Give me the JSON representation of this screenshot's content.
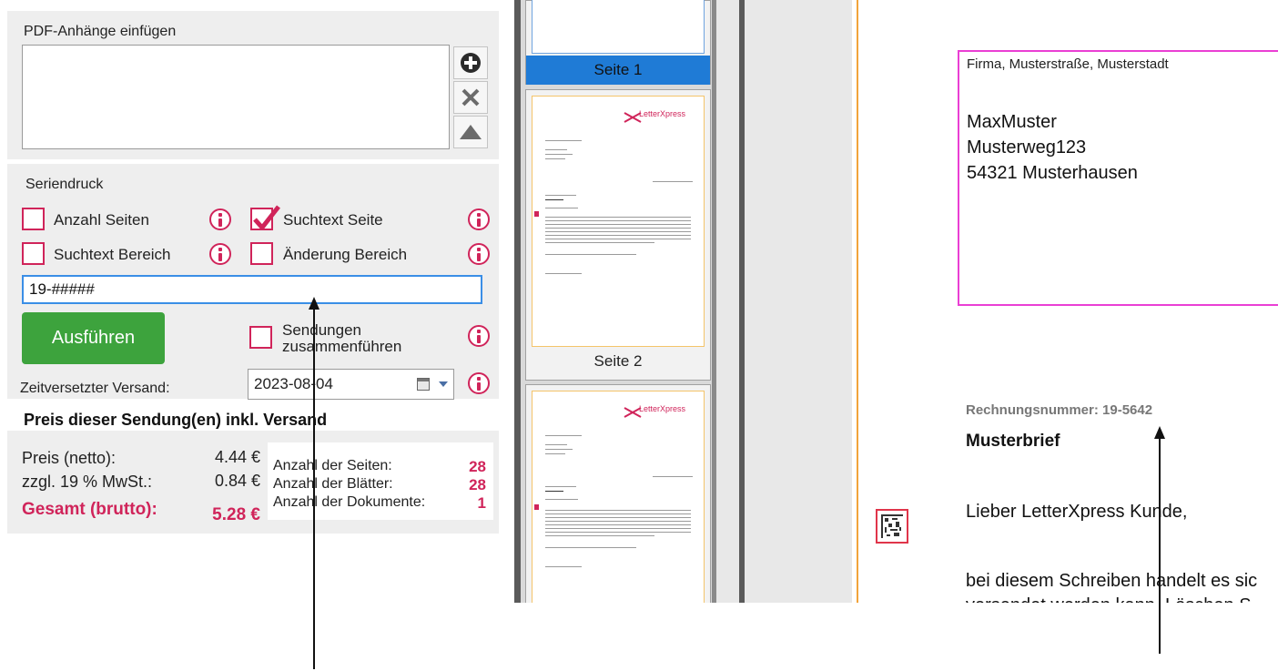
{
  "attachments": {
    "title": "PDF-Anhänge einfügen",
    "buttons": {
      "add_icon": "plus-circle-icon",
      "remove_icon": "close-icon",
      "up_icon": "arrow-up-icon"
    }
  },
  "serial": {
    "title": "Seriendruck",
    "options": [
      {
        "label": "Anzahl Seiten",
        "checked": false
      },
      {
        "label": "Suchtext Seite",
        "checked": true
      },
      {
        "label": "Suchtext Bereich",
        "checked": false
      },
      {
        "label": "Änderung Bereich",
        "checked": false
      }
    ],
    "search_value": "19-#####",
    "run_label": "Ausführen",
    "merge_label_line1": "Sendungen",
    "merge_label_line2": "zusammenführen",
    "delayed_label": "Zeitversetzter Versand:",
    "delayed_date": "2023-08-04"
  },
  "price": {
    "heading": "Preis dieser Sendung(en) inkl. Versand",
    "net_label": "Preis (netto):",
    "net_value": "4.44 €",
    "vat_label": "zzgl. 19 % MwSt.:",
    "vat_value": "0.84 €",
    "total_label": "Gesamt (brutto):",
    "total_value": "5.28 €",
    "pages_label": "Anzahl der Seiten:",
    "pages_value": "28",
    "sheets_label": "Anzahl der Blätter:",
    "sheets_value": "28",
    "docs_label": "Anzahl der Dokumente:",
    "docs_value": "1",
    "accent_color": "#d0245a"
  },
  "thumbnails": {
    "pages": [
      {
        "label": "Seite 1",
        "selected": true
      },
      {
        "label": "Seite 2",
        "selected": false
      },
      {
        "label": "",
        "selected": false
      }
    ],
    "logo_text": "LetterXpress"
  },
  "document": {
    "sender_line": "Firma, Musterstraße, Musterstadt",
    "recipient": [
      "MaxMuster",
      "Musterweg123",
      "54321 Musterhausen"
    ],
    "invoice_number": "Rechnungsnummer: 19-5642",
    "title": "Musterbrief",
    "salutation": "Lieber LetterXpress Kunde,",
    "body_line1": "bei diesem Schreiben handelt es sic",
    "body_line2": "versendet werden kann. Löschen S"
  }
}
